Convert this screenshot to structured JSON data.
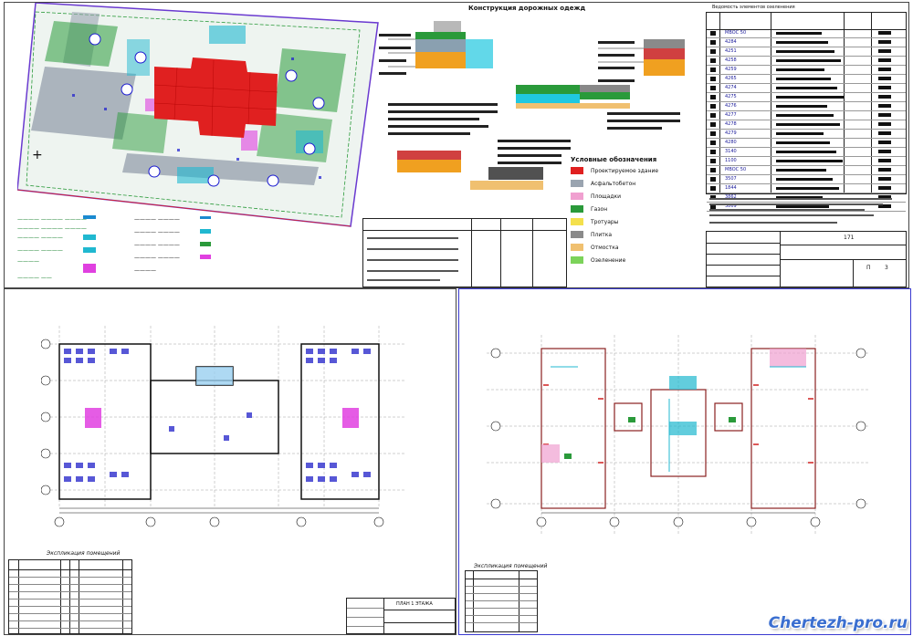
{
  "sheet1": {
    "title": "Конструкция дорожных одежд",
    "legend_title": "Условные обозначения",
    "legend_items": [
      {
        "label": "Проектируемое здание",
        "color": "#e02020"
      },
      {
        "label": "Асфальтобетон",
        "color": "#9aa4b0"
      },
      {
        "label": "Площадки",
        "color": "#f0a0d0"
      },
      {
        "label": "Газон",
        "color": "#2a9a3a"
      },
      {
        "label": "Тротуары",
        "color": "#f4e04c"
      },
      {
        "label": "Плитка",
        "color": "#8a8a8a"
      },
      {
        "label": "Отмостка",
        "color": "#f0c070"
      },
      {
        "label": "Озеленение",
        "color": "#7cd35a"
      }
    ],
    "table_title": "Ведомость элементов озеленения",
    "stamp_numbers": [
      "171",
      "П",
      "3"
    ],
    "rows": [
      "МВОС 50",
      "4284",
      "4251",
      "4258",
      "4259",
      "4265",
      "4274",
      "4275",
      "4276",
      "4277",
      "4278",
      "4279",
      "4280",
      "3140",
      "1100",
      "МВОС 50",
      "3507",
      "1844",
      "3862",
      "3869"
    ]
  },
  "sheet2": {
    "title": "Экспликация помещений",
    "stamp_label": "ПЛАН 1 ЭТАЖА"
  },
  "sheet3": {
    "title": "Экспликация помещений"
  },
  "watermark": "Chertezh-pro.ru",
  "colors": {
    "building_red": "#e02020",
    "road_gray": "#9aa4b0",
    "green": "#2a9a3a",
    "magenta": "#e040e0",
    "blue_plan": "#3a3ad0",
    "cyan": "#20b8d0"
  }
}
